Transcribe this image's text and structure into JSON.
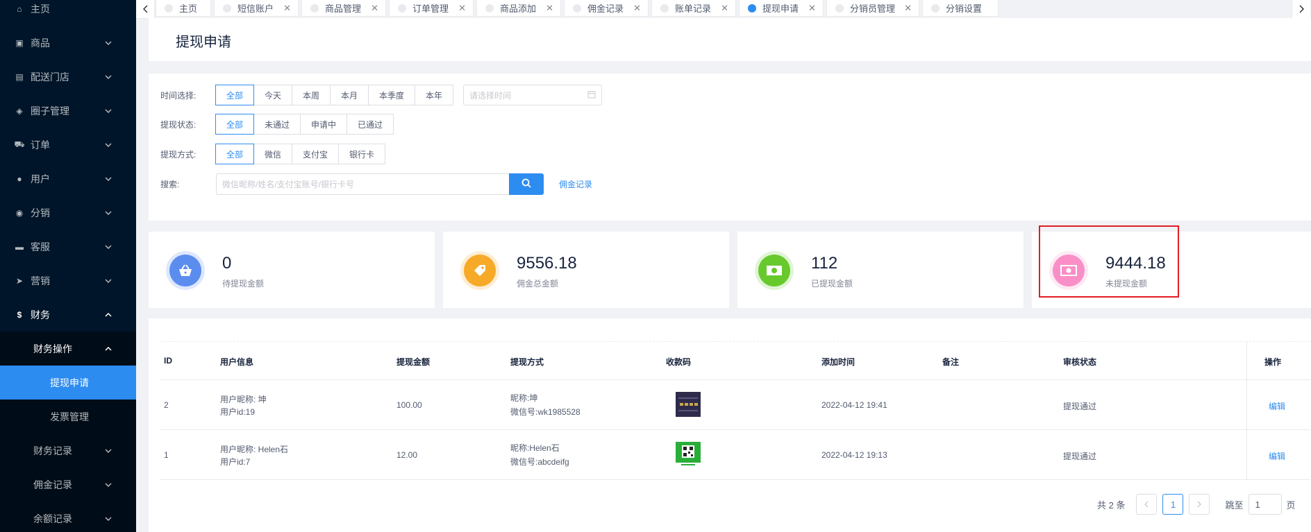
{
  "sidebar": {
    "items": [
      {
        "label": "主页",
        "icon": "home-icon"
      },
      {
        "label": "商品",
        "icon": "bag-icon"
      },
      {
        "label": "配送门店",
        "icon": "store-icon"
      },
      {
        "label": "圈子管理",
        "icon": "shield-icon"
      },
      {
        "label": "订单",
        "icon": "cart-icon"
      },
      {
        "label": "用户",
        "icon": "user-icon"
      },
      {
        "label": "分销",
        "icon": "robot-icon"
      },
      {
        "label": "客服",
        "icon": "chat-icon"
      },
      {
        "label": "营销",
        "icon": "send-icon"
      },
      {
        "label": "财务",
        "icon": "dollar-icon"
      },
      {
        "label": "财务操作"
      },
      {
        "label": "提现申请"
      },
      {
        "label": "发票管理"
      },
      {
        "label": "财务记录"
      },
      {
        "label": "佣金记录"
      },
      {
        "label": "余额记录"
      }
    ]
  },
  "tabs": [
    {
      "label": "主页"
    },
    {
      "label": "短信账户"
    },
    {
      "label": "商品管理"
    },
    {
      "label": "订单管理"
    },
    {
      "label": "商品添加"
    },
    {
      "label": "佣金记录"
    },
    {
      "label": "账单记录"
    },
    {
      "label": "提现申请"
    },
    {
      "label": "分销员管理"
    },
    {
      "label": "分销设置"
    }
  ],
  "page": {
    "title": "提现申请"
  },
  "filters": {
    "time": {
      "label": "时间选择:",
      "options": [
        "全部",
        "今天",
        "本周",
        "本月",
        "本季度",
        "本年"
      ],
      "date_placeholder": "请选择时间"
    },
    "status": {
      "label": "提现状态:",
      "options": [
        "全部",
        "未通过",
        "申请中",
        "已通过"
      ]
    },
    "method": {
      "label": "提现方式:",
      "options": [
        "全部",
        "微信",
        "支付宝",
        "银行卡"
      ]
    },
    "search": {
      "label": "搜索:",
      "placeholder": "微信昵称/姓名/支付宝账号/银行卡号",
      "link": "佣金记录"
    }
  },
  "stats": [
    {
      "value": "0",
      "caption": "待提现金额",
      "color": "#5b8def",
      "icon": "basket-icon"
    },
    {
      "value": "9556.18",
      "caption": "佣金总金额",
      "color": "#f7a928",
      "icon": "tag-icon"
    },
    {
      "value": "112",
      "caption": "已提现金额",
      "color": "#68c92d",
      "icon": "money-icon"
    },
    {
      "value": "9444.18",
      "caption": "未提现金额",
      "color": "#f98fc6",
      "icon": "cash-icon"
    }
  ],
  "table": {
    "headers": [
      "ID",
      "用户信息",
      "提现金额",
      "提现方式",
      "收款码",
      "添加时间",
      "备注",
      "审核状态",
      "操作"
    ],
    "rows": [
      {
        "id": "2",
        "nick": "用户昵称: 坤",
        "uid": "用户id:19",
        "amount": "100.00",
        "m1": "昵称:坤",
        "m2": "微信号:wk1985528",
        "time": "2022-04-12 19:41",
        "status": "提现通过",
        "action": "编辑"
      },
      {
        "id": "1",
        "nick": "用户昵称: Helen石",
        "uid": "用户id:7",
        "amount": "12.00",
        "m1": "昵称:Helen石",
        "m2": "微信号:abcdeifg",
        "time": "2022-04-12 19:13",
        "status": "提现通过",
        "action": "编辑"
      }
    ]
  },
  "pagination": {
    "total": "共 2 条",
    "current": "1",
    "jump_label": "跳至",
    "jump_value": "1",
    "page_suffix": "页"
  }
}
